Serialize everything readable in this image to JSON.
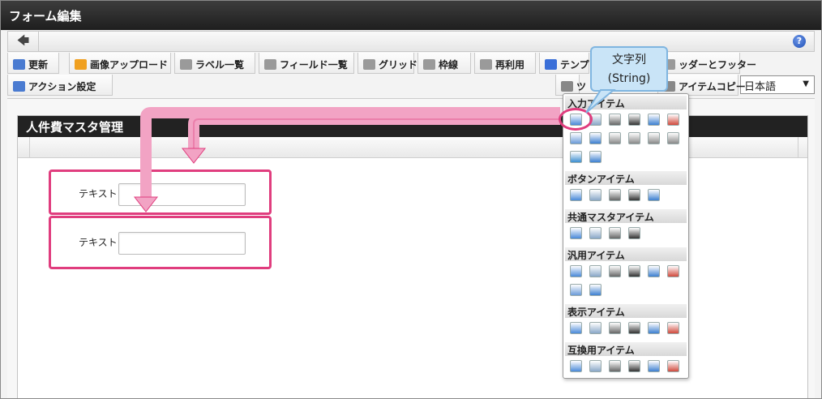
{
  "window": {
    "title": "フォーム編集"
  },
  "nav": {
    "back_glyph": "🡄",
    "help_glyph": "?"
  },
  "toolbar": {
    "row1": [
      {
        "label": "更新",
        "icon": "refresh-icon",
        "color": "#4a7bd1"
      },
      {
        "label": "画像アップロード",
        "icon": "image-upload-icon",
        "color": "#f0a020"
      },
      {
        "label": "ラベル一覧",
        "icon": "label-list-icon",
        "color": "#9a9a9a"
      },
      {
        "label": "フィールド一覧",
        "icon": "field-list-icon",
        "color": "#9a9a9a"
      },
      {
        "label": "グリッド",
        "icon": "grid-icon",
        "color": "#9a9a9a"
      },
      {
        "label": "枠線",
        "icon": "border-icon",
        "color": "#9a9a9a"
      },
      {
        "label": "再利用",
        "icon": "reuse-icon",
        "color": "#9a9a9a"
      },
      {
        "label": "テンプ",
        "icon": "template-icon",
        "color": "#3a6fd8"
      },
      {
        "label": "ッダーとフッター",
        "icon": "header-footer-icon",
        "color": "#9a9a9a"
      }
    ],
    "row2": [
      {
        "label": "アクション設定",
        "icon": "action-settings-icon",
        "color": "#4a7bd1"
      },
      {
        "label": "ツ",
        "icon": "toolbox-icon",
        "color": "#888888"
      },
      {
        "label": "アイテムコピー",
        "icon": "item-copy-icon",
        "color": "#888888"
      }
    ],
    "language": "日本語"
  },
  "form": {
    "title": "人件費マスタ管理",
    "fields": [
      {
        "label": "テキスト",
        "value": ""
      },
      {
        "label": "テキスト",
        "value": ""
      }
    ]
  },
  "callout": {
    "line1": "文字列",
    "line2": "(String)"
  },
  "palette": {
    "sections": [
      {
        "title": "入力アイテム",
        "icons": [
          "string-icon",
          "number-icon",
          "decimal-icon",
          "formula-icon",
          "date-icon",
          "datetime-icon",
          "textarea-icon",
          "table-icon",
          "checkbox-icon",
          "radio-icon",
          "select-icon",
          "list-icon",
          "file-upload-icon",
          "grid-input-icon"
        ]
      },
      {
        "title": "ボタンアイテム",
        "icons": [
          "register-button-icon",
          "next-button-icon",
          "back-button-icon",
          "return-button-icon",
          "forward-button-icon"
        ]
      },
      {
        "title": "共通マスタアイテム",
        "icons": [
          "user-icon",
          "organization-icon",
          "position-icon",
          "public-group-icon"
        ]
      },
      {
        "title": "汎用アイテム",
        "icons": [
          "hidden-icon",
          "document-icon",
          "camera-icon",
          "attachment-icon",
          "copy-icon",
          "download-icon",
          "list-item-icon",
          "image-viewer-icon"
        ]
      },
      {
        "title": "表示アイテム",
        "icons": [
          "label-icon",
          "horizontal-line-icon",
          "vertical-line-icon",
          "box-icon",
          "image-icon",
          "text-icon"
        ]
      },
      {
        "title": "互換用アイテム",
        "icons": [
          "legacy-textarea-icon",
          "legacy-table-icon",
          "legacy-checkbox-icon",
          "legacy-radio-icon",
          "legacy-select-icon",
          "legacy-list-icon"
        ]
      }
    ]
  },
  "colors": {
    "accent_pink": "#e03d7e",
    "callout_blue": "#c9e4f7"
  }
}
